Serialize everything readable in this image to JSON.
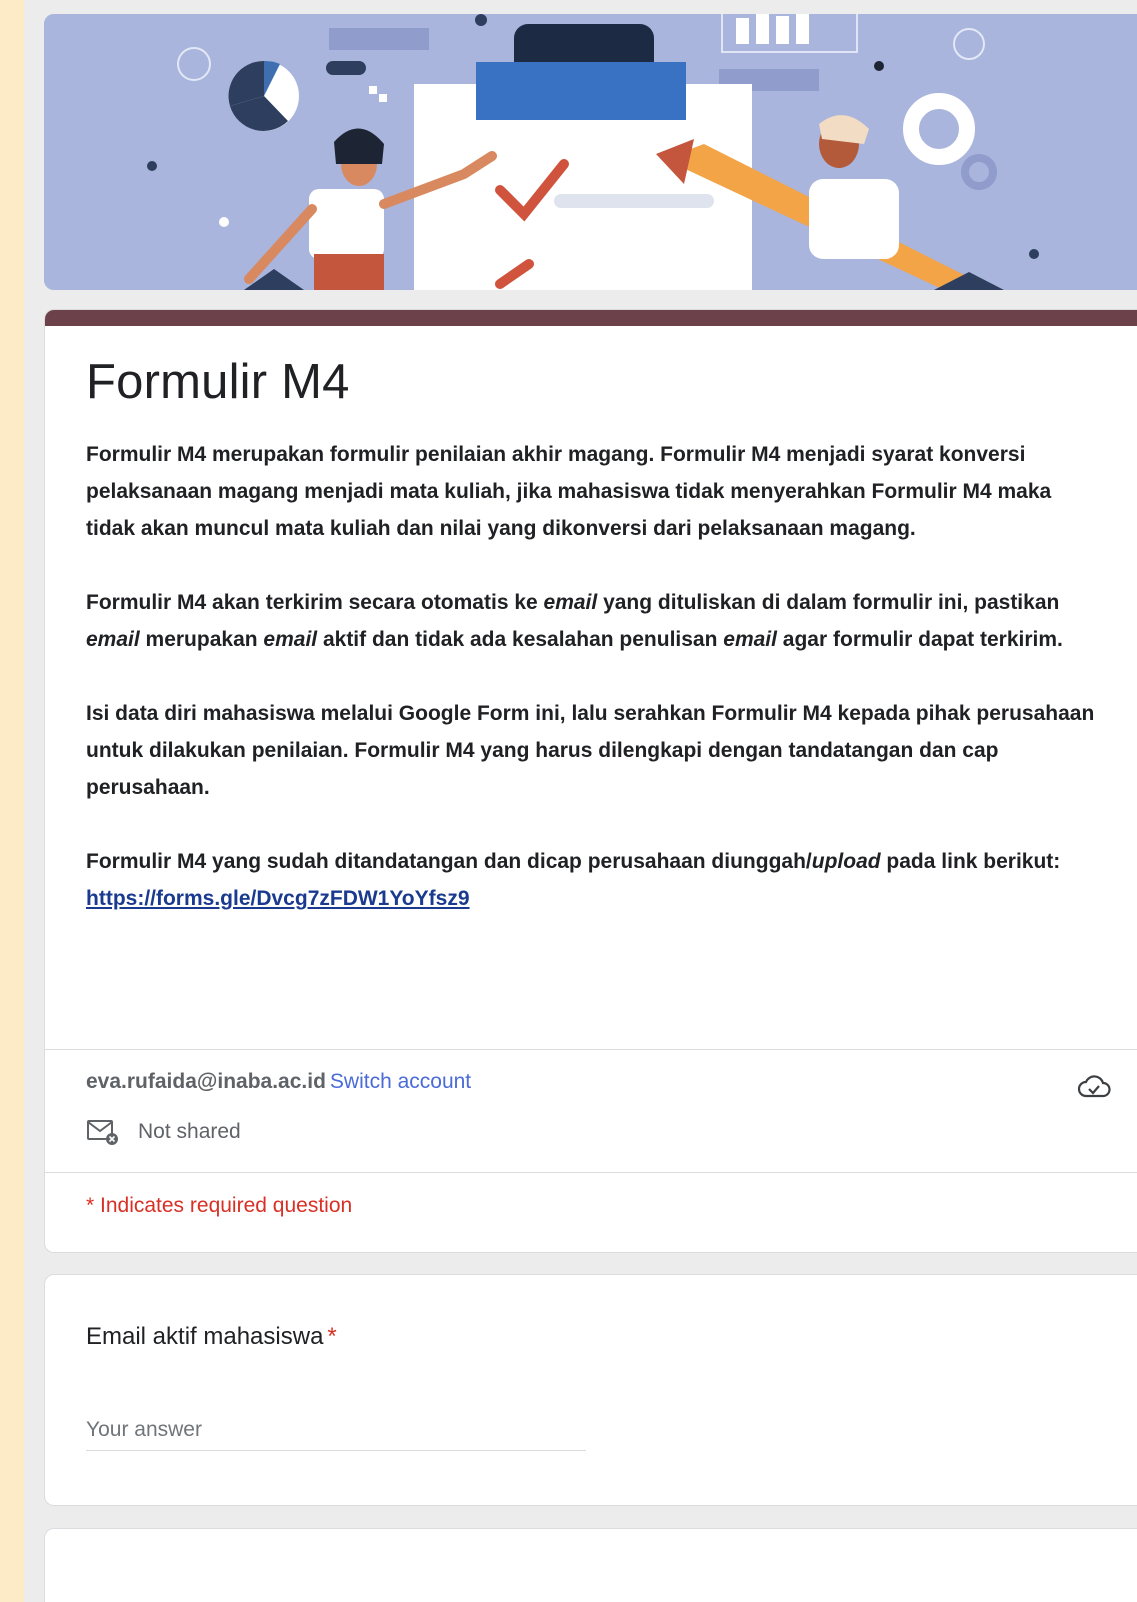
{
  "form": {
    "title": "Formulir M4",
    "description": {
      "p1": "Formulir M4 merupakan formulir penilaian akhir magang. Formulir M4 menjadi syarat konversi pelaksanaan magang menjadi mata kuliah, jika mahasiswa tidak menyerahkan Formulir M4 maka tidak akan muncul mata kuliah dan nilai yang dikonversi dari pelaksanaan magang.",
      "p2_a": "Formulir M4 akan terkirim secara otomatis ke ",
      "p2_em1": "email",
      "p2_b": " yang dituliskan di dalam formulir ini, pastikan ",
      "p2_em2": "email",
      "p2_c": " merupakan ",
      "p2_em3": "email",
      "p2_d": " aktif dan tidak ada kesalahan penulisan ",
      "p2_em4": "email",
      "p2_e": " agar formulir dapat terkirim.",
      "p3": "Isi data diri mahasiswa melalui Google Form ini, lalu serahkan Formulir M4 kepada pihak perusahaan untuk dilakukan penilaian. Formulir M4 yang harus dilengkapi dengan tandatangan dan cap perusahaan.",
      "p4_a": "Formulir M4 yang sudah ditandatangan dan dicap perusahaan diunggah/",
      "p4_em": "upload",
      "p4_b": " pada link berikut:",
      "link": "https://forms.gle/Dvcg7zFDW1YoYfsz9"
    }
  },
  "account": {
    "email": "eva.rufaida@inaba.ac.id",
    "switch_label": "Switch account",
    "shared_status": "Not shared",
    "cloud_icon": "cloud-done-icon",
    "mail_icon": "mail-off-icon"
  },
  "required_note": "* Indicates required question",
  "questions": [
    {
      "label": "Email aktif mahasiswa",
      "required_marker": "*",
      "placeholder": "Your answer"
    }
  ],
  "colors": {
    "accent_bar": "#6d4149",
    "required": "#d93025",
    "link": "#1a3a8f",
    "switch_link": "#4a6bd8",
    "page_bg": "#ececec",
    "left_strip": "#fdebc8"
  }
}
